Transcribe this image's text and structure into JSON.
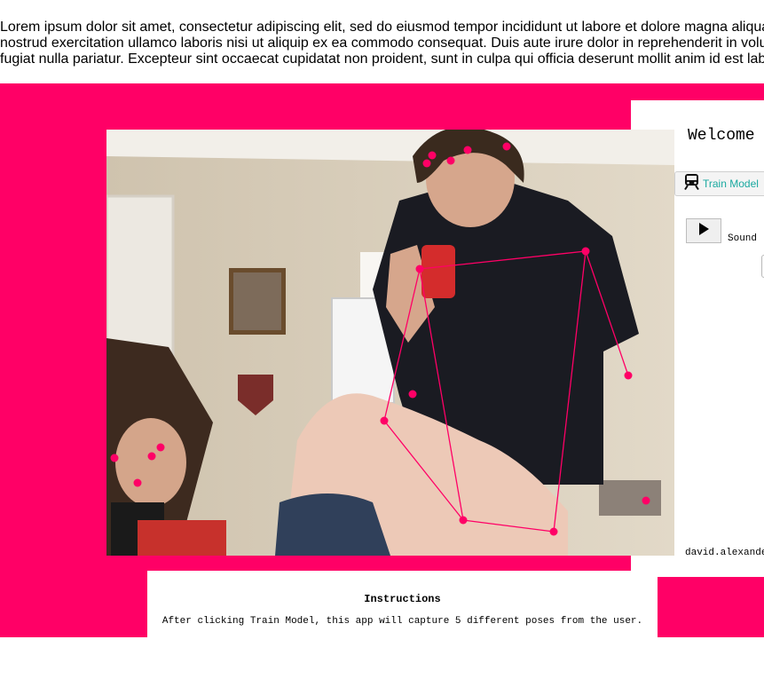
{
  "intro_text": {
    "line1": "Lorem ipsum dolor sit amet, consectetur adipiscing elit, sed do eiusmod tempor incididunt ut labore et dolore magna aliqua. Ut enim ad minim veniam, quis",
    "line2": "nostrud exercitation ullamco laboris nisi ut aliquip ex ea commodo consequat. Duis aute irure dolor in reprehenderit in voluptate velit esse cillum dolore eu",
    "line3": "fugiat nulla pariatur. Excepteur sint occaecat cupidatat non proident, sunt in culpa qui officia deserunt mollit anim id est laborum."
  },
  "panel": {
    "welcome": "Welcome",
    "train_button_label": "Train Model",
    "train_icon": "train-icon",
    "play_icon": "play-icon",
    "sound_label": "Sound",
    "user_email": "david.alexande"
  },
  "instructions": {
    "title": "Instructions",
    "text": "After clicking Train Model, this app will capture 5 different poses from the user."
  },
  "colors": {
    "accent_pink": "#ff0066",
    "train_label_teal": "#1aa9a0"
  },
  "pose_overlay": {
    "keypoint_color": "#ff0066",
    "skeleton_color": "#ff0066"
  }
}
